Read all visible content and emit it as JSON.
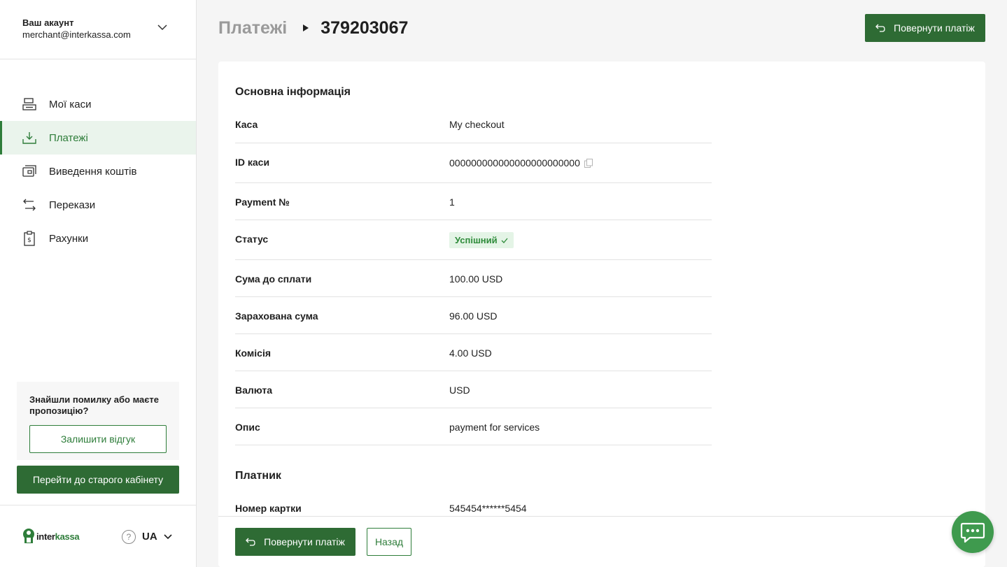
{
  "account": {
    "title": "Ваш акаунт",
    "email": "merchant@interkassa.com"
  },
  "nav": [
    {
      "label": "Мої каси",
      "icon": "checkout-icon",
      "active": false
    },
    {
      "label": "Платежі",
      "icon": "download-icon",
      "active": true
    },
    {
      "label": "Виведення коштів",
      "icon": "withdraw-icon",
      "active": false
    },
    {
      "label": "Перекази",
      "icon": "transfer-icon",
      "active": false
    },
    {
      "label": "Рахунки",
      "icon": "invoice-icon",
      "active": false
    }
  ],
  "feedback": {
    "text": "Знайшли помилку або маєте пропозицію?",
    "button": "Залишити відгук"
  },
  "old_cabinet": "Перейти до старого кабінету",
  "logo": {
    "part1": "inter",
    "part2": "kassa"
  },
  "help": "?",
  "language": "UA",
  "breadcrumb": {
    "root": "Платежі",
    "current": "379203067"
  },
  "refund_button": "Повернути платіж",
  "back_button": "Назад",
  "section_main": "Основна інформація",
  "section_payer": "Платник",
  "rows": [
    {
      "label": "Каса",
      "value": "My checkout"
    },
    {
      "label": "ID каси",
      "value": "000000000000000000000000"
    },
    {
      "label": "Payment №",
      "value": "1"
    },
    {
      "label": "Статус",
      "value": "Успішний"
    },
    {
      "label": "Сума до сплати",
      "value": "100.00 USD"
    },
    {
      "label": "Зарахована сума",
      "value": "96.00 USD"
    },
    {
      "label": "Комісія",
      "value": "4.00 USD"
    },
    {
      "label": "Валюта",
      "value": "USD"
    },
    {
      "label": "Опис",
      "value": "payment for services"
    }
  ],
  "payer_rows": [
    {
      "label": "Номер картки",
      "value": "545454******5454"
    }
  ],
  "colors": {
    "primary": "#2e6b34",
    "accent": "#2e7d3a",
    "success_bg": "#e4f4e6",
    "chat": "#3f9a4e"
  }
}
